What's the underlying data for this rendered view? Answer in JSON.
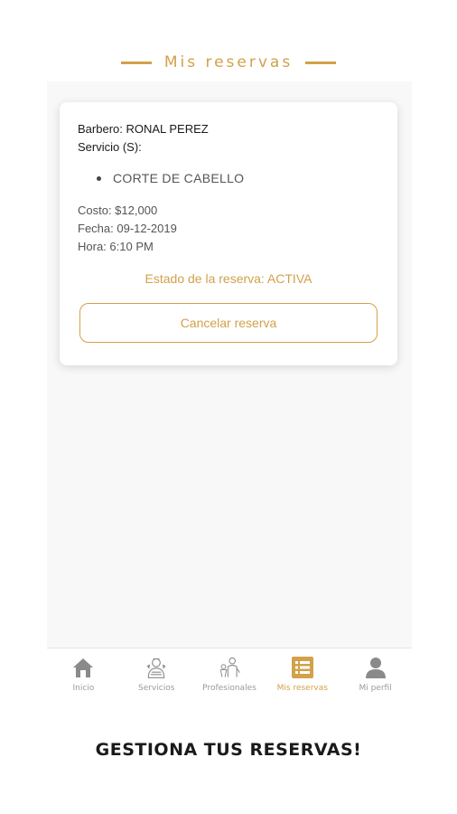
{
  "header": {
    "title": "Mis reservas"
  },
  "reservation": {
    "barbero": "Barbero: RONAL PEREZ",
    "servicio_label": "Servicio (S):",
    "services": [
      "CORTE DE CABELLO"
    ],
    "costo": "Costo: $12,000",
    "fecha": "Fecha: 09-12-2019",
    "hora": "Hora: 6:10 PM",
    "estado": "Estado de la reserva: ACTIVA",
    "cancel_label": "Cancelar reserva"
  },
  "tabs": [
    {
      "label": "Inicio",
      "icon": "home-icon"
    },
    {
      "label": "Servicios",
      "icon": "barber-icon"
    },
    {
      "label": "Profesionales",
      "icon": "professionals-icon"
    },
    {
      "label": "Mis reservas",
      "icon": "list-icon",
      "active": true
    },
    {
      "label": "Mi perfil",
      "icon": "user-icon"
    }
  ],
  "footer": {
    "text": "GESTIONA TUS RESERVAS!"
  },
  "colors": {
    "accent": "#d2a14a",
    "tab_inactive": "#9a9a9a"
  }
}
